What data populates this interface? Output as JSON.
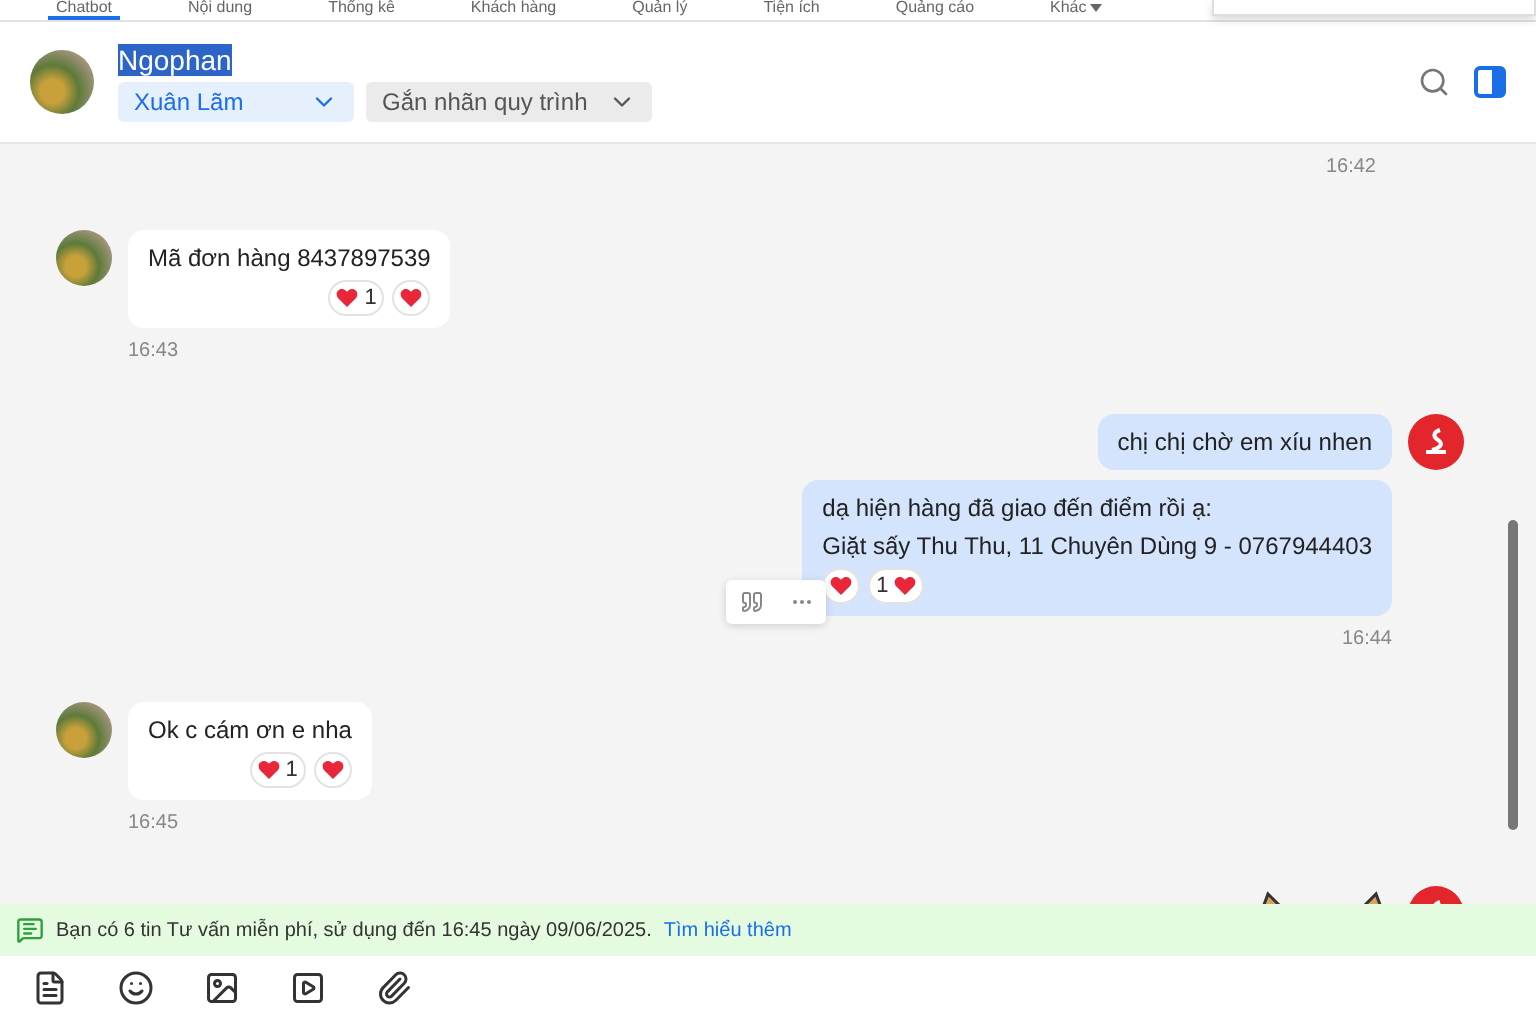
{
  "nav_tabs": [
    {
      "label": "Chatbot",
      "selected": true
    },
    {
      "label": "Nội dung",
      "selected": false
    },
    {
      "label": "Thống kê",
      "selected": false
    },
    {
      "label": "Khách hàng",
      "selected": false
    },
    {
      "label": "Quản lý",
      "selected": false
    },
    {
      "label": "Tiện ích",
      "selected": false
    },
    {
      "label": "Quảng cáo",
      "selected": false
    },
    {
      "label": "Khác",
      "selected": false,
      "has_caret": true
    }
  ],
  "header": {
    "name": "Ngophan",
    "name_highlighted": true,
    "assignee": "Xuân Lãm",
    "label_picker": "Gắn nhãn quy trình"
  },
  "messages": [
    {
      "kind": "time",
      "time": "16:42"
    },
    {
      "kind": "incoming",
      "show_avatar": true,
      "lines": [
        "Mã đơn hàng 8437897539"
      ],
      "reactions": [
        {
          "kind": "trailing",
          "count": "1"
        },
        {
          "kind": "plain"
        }
      ],
      "time": "16:43"
    },
    {
      "kind": "outgoing",
      "show_avatar": true,
      "lines": [
        "chị chị chờ em xíu nhen"
      ]
    },
    {
      "kind": "outgoing",
      "show_avatar": false,
      "hover_actions": true,
      "lines": [
        "dạ hiện hàng đã giao đến điểm rồi ạ:",
        "Giặt sấy Thu Thu, 11 Chuyên Dùng 9 - 0767944403"
      ],
      "reactions": [
        {
          "kind": "plain"
        },
        {
          "kind": "leading",
          "count": "1"
        }
      ],
      "time": "16:44"
    },
    {
      "kind": "incoming",
      "show_avatar": true,
      "lines": [
        "Ok c cám ơn e nha"
      ],
      "reactions": [
        {
          "kind": "trailing",
          "count": "1"
        },
        {
          "kind": "plain"
        }
      ],
      "time": "16:45"
    },
    {
      "kind": "sticker",
      "show_avatar": true
    }
  ],
  "notice": {
    "text": "Bạn có 6 tin Tư vấn miễn phí, sử dụng đến 16:45 ngày 09/06/2025.",
    "link": "Tìm hiểu thêm"
  }
}
